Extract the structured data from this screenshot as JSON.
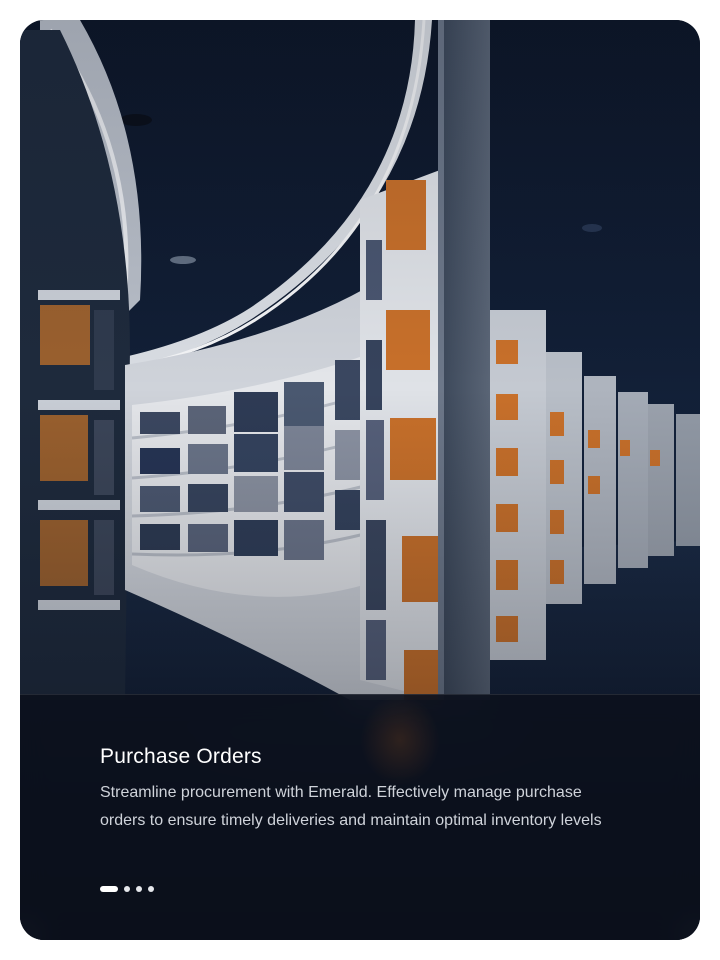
{
  "slide": {
    "title": "Purchase Orders",
    "description": "Streamline procurement with Emerald. Effectively manage purchase orders to ensure timely deliveries and maintain optimal inventory levels",
    "image_subject": "library-bookshelves",
    "active_index": 0,
    "total": 4
  },
  "pagination": {
    "dots": [
      "slide-1",
      "slide-2",
      "slide-3",
      "slide-4"
    ]
  },
  "colors": {
    "panel_bg": "#0c101c",
    "title": "#ffffff",
    "text": "#cfd3da",
    "accent_book": "#c8702a"
  }
}
